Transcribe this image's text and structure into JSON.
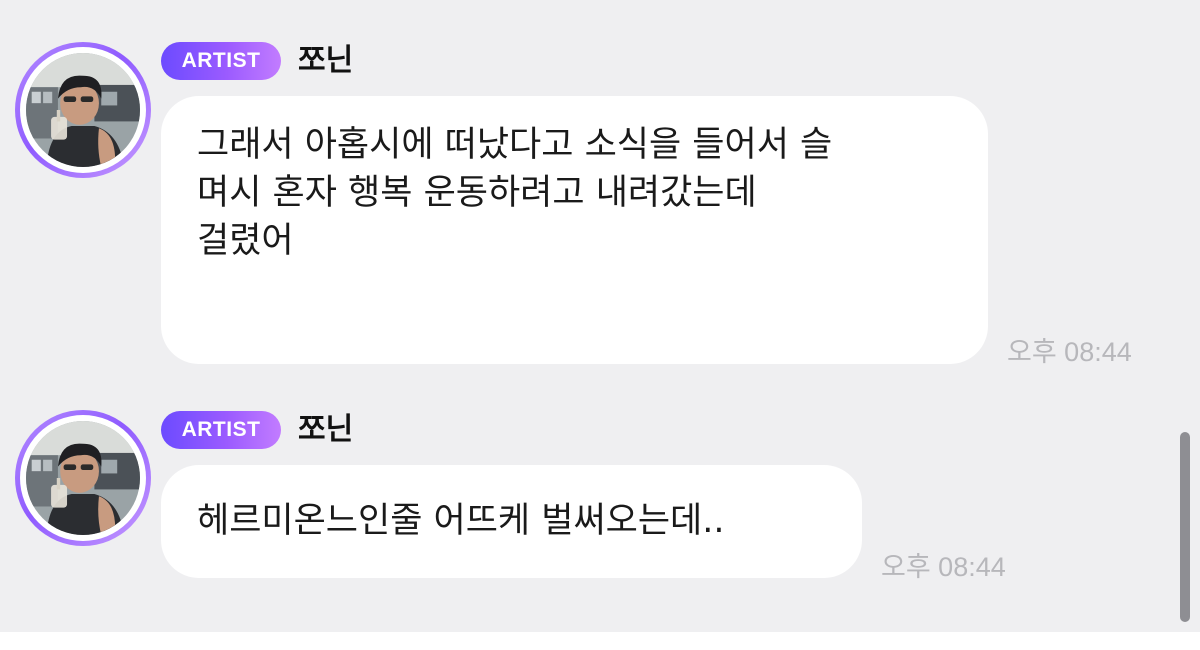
{
  "messages": [
    {
      "badge": "ARTIST",
      "sender": "쪼닌",
      "lines": [
        "그래서 아홉시에 떠났다고 소식을 들어서 슬",
        "며시 혼자 행복 운동하려고 내려갔는데",
        "걸렸어"
      ],
      "time": "오후 08:44"
    },
    {
      "badge": "ARTIST",
      "sender": "쪼닌",
      "lines": [
        "헤르미온느인줄 어뜨케 벌써오는데.."
      ],
      "time": "오후 08:44"
    }
  ],
  "colors": {
    "background": "#efeff1",
    "bubble": "#ffffff",
    "badge_start": "#6c4bff",
    "badge_end": "#c27cff",
    "timestamp": "#b7b7bb"
  },
  "icons": {
    "avatar": "artist-profile-photo"
  }
}
